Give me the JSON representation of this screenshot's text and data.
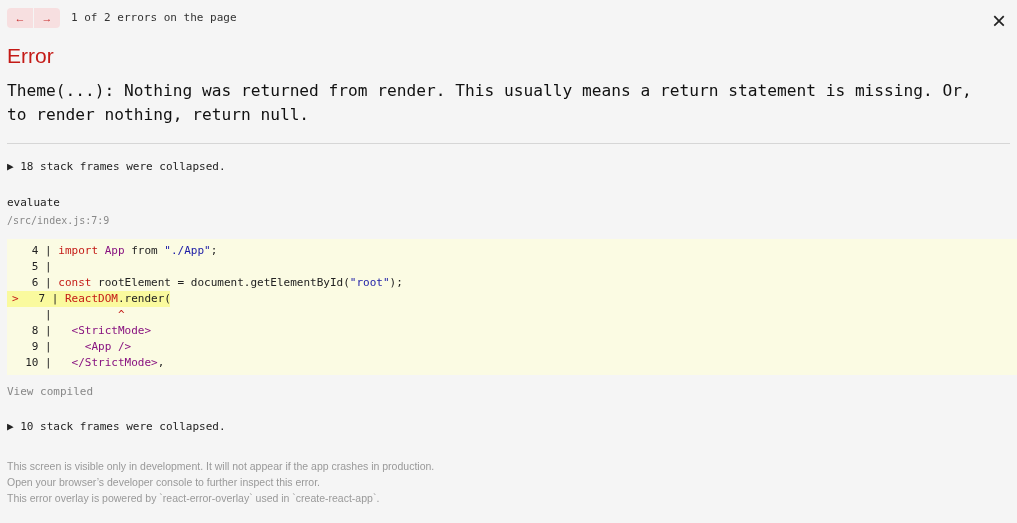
{
  "nav": {
    "prev": "←",
    "next": "→",
    "counter": "1 of 2 errors on the page",
    "close": "×"
  },
  "title": "Error",
  "message": "Theme(...): Nothing was returned from render. This usually means a return statement is missing. Or, to render nothing, return null.",
  "stack_top": {
    "toggle": "▶ 18 stack frames were collapsed.",
    "expanded": false
  },
  "frame": {
    "function": "evaluate",
    "location": "/src/index.js:7:9",
    "lines": [
      {
        "gutter": "   4 | ",
        "highlighted": false,
        "tokens": [
          {
            "kind": "keyword",
            "text": "import"
          },
          {
            "kind": "tag",
            "text": " App"
          },
          {
            "kind": "plain",
            "text": " from "
          },
          {
            "kind": "string",
            "text": "\"./App\""
          },
          {
            "kind": "plain",
            "text": ";"
          }
        ]
      },
      {
        "gutter": "   5 |",
        "highlighted": false
      },
      {
        "gutter": "   6 | ",
        "highlighted": false,
        "tokens": [
          {
            "kind": "keyword",
            "text": "const"
          },
          {
            "kind": "plain",
            "text": " rootElement = document.getElementById("
          },
          {
            "kind": "string",
            "text": "\"root\""
          },
          {
            "kind": "plain",
            "text": ");"
          }
        ]
      },
      {
        "marker": ">",
        "gutter": "  7 | ",
        "highlighted": true,
        "tokens": [
          {
            "kind": "keyword",
            "text": "ReactDOM"
          },
          {
            "kind": "plain",
            "text": ".render("
          }
        ]
      },
      {
        "gutter": "     | ",
        "highlighted": false,
        "tokens": [
          {
            "kind": "keyword",
            "text": "         ^"
          }
        ]
      },
      {
        "gutter": "   8 | ",
        "highlighted": false,
        "tokens": [
          {
            "kind": "tag",
            "text": "  <StrictMode>"
          }
        ]
      },
      {
        "gutter": "   9 | ",
        "highlighted": false,
        "tokens": [
          {
            "kind": "tag",
            "text": "    <App />"
          }
        ]
      },
      {
        "gutter": "  10 | ",
        "highlighted": false,
        "tokens": [
          {
            "kind": "tag",
            "text": "  </StrictMode>"
          },
          {
            "kind": "plain",
            "text": ","
          }
        ]
      }
    ],
    "view_compiled": "View compiled"
  },
  "stack_bottom": {
    "toggle": "▶ 10 stack frames were collapsed.",
    "expanded": false
  },
  "footer": [
    "This screen is visible only in development. It will not appear if the app crashes in production.",
    "Open your browser’s developer console to further inspect this error.",
    "This error overlay is powered by `react-error-overlay` used in `create-react-app`."
  ]
}
